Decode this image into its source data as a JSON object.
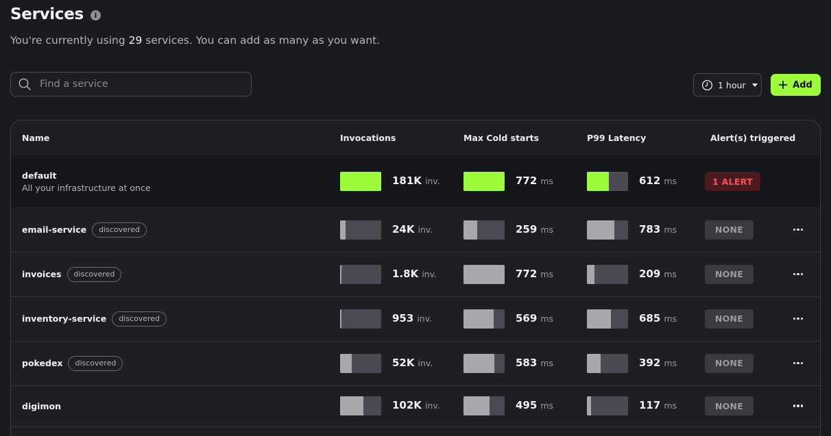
{
  "header": {
    "title": "Services",
    "subtitle_prefix": "You're currently using ",
    "service_count": "29",
    "subtitle_suffix": " services. You can add as many as you want."
  },
  "search": {
    "placeholder": "Find a service",
    "value": ""
  },
  "time_range": {
    "selected": "1 hour"
  },
  "add_button": {
    "label": "Add"
  },
  "table": {
    "columns": [
      "Name",
      "Invocations",
      "Max Cold starts",
      "P99 Latency",
      "Alert(s) triggered"
    ],
    "rows": [
      {
        "name": "default",
        "description": "All your infrastructure at once",
        "badge": "",
        "invocations": "181K",
        "invocations_unit": "inv.",
        "inv_fill": 1.0,
        "cold": "772",
        "cold_unit": "ms",
        "cold_fill": 1.0,
        "p99": "612",
        "p99_unit": "ms",
        "p99_fill": 0.53,
        "alert": "1 ALERT",
        "alert_status": "alert"
      },
      {
        "name": "email-service",
        "badge": "discovered",
        "invocations": "24K",
        "invocations_unit": "inv.",
        "inv_fill": 0.13,
        "cold": "259",
        "cold_unit": "ms",
        "cold_fill": 0.34,
        "p99": "783",
        "p99_unit": "ms",
        "p99_fill": 0.67,
        "alert": "NONE",
        "alert_status": "none"
      },
      {
        "name": "invoices",
        "badge": "discovered",
        "invocations": "1.8K",
        "invocations_unit": "inv.",
        "inv_fill": 0.01,
        "cold": "772",
        "cold_unit": "ms",
        "cold_fill": 1.0,
        "p99": "209",
        "p99_unit": "ms",
        "p99_fill": 0.18,
        "alert": "NONE",
        "alert_status": "none"
      },
      {
        "name": "inventory-service",
        "badge": "discovered",
        "invocations": "953",
        "invocations_unit": "inv.",
        "inv_fill": 0.005,
        "cold": "569",
        "cold_unit": "ms",
        "cold_fill": 0.73,
        "p99": "685",
        "p99_unit": "ms",
        "p99_fill": 0.58,
        "alert": "NONE",
        "alert_status": "none"
      },
      {
        "name": "pokedex",
        "badge": "discovered",
        "invocations": "52K",
        "invocations_unit": "inv.",
        "inv_fill": 0.29,
        "cold": "583",
        "cold_unit": "ms",
        "cold_fill": 0.75,
        "p99": "392",
        "p99_unit": "ms",
        "p99_fill": 0.33,
        "alert": "NONE",
        "alert_status": "none"
      },
      {
        "name": "digimon",
        "badge": "",
        "invocations": "102K",
        "invocations_unit": "inv.",
        "inv_fill": 0.56,
        "cold": "495",
        "cold_unit": "ms",
        "cold_fill": 0.64,
        "p99": "117",
        "p99_unit": "ms",
        "p99_fill": 0.1,
        "alert": "NONE",
        "alert_status": "none"
      }
    ]
  },
  "colors": {
    "accent": "#9dfb3c",
    "alert": "#ff4d5a",
    "background": "#1a1b1f"
  },
  "icons": {
    "info": "info-icon",
    "search": "search-icon",
    "clock": "clock-icon",
    "plus": "plus-icon",
    "more": "more-icon"
  }
}
